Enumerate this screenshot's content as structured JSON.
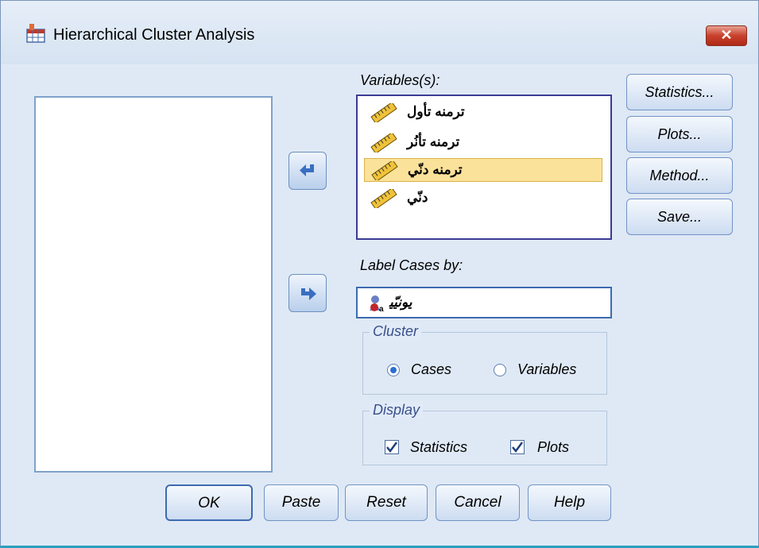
{
  "window": {
    "title": "Hierarchical Cluster Analysis",
    "close_label": "✕"
  },
  "variables": {
    "label": "Variables(s):",
    "items": [
      {
        "text": "ﺗﺮﻣﻨﻪ ﺗﺄﻭﻝ",
        "selected": false
      },
      {
        "text": "ﺗﺮﻣﻨﻪ ﺗﺄﻧُﺮ",
        "selected": false
      },
      {
        "text": "ﺗﺮﻣﻨﻪ ﺩﻧّﻲ",
        "selected": true
      },
      {
        "text": "ﺩﻧّﻲ",
        "selected": false
      }
    ]
  },
  "label_cases": {
    "label": "Label Cases by:",
    "value": "ﻳﻮﻧﻴّﻴ"
  },
  "side_buttons": {
    "statistics": "Statistics...",
    "plots": "Plots...",
    "method": "Method...",
    "save": "Save..."
  },
  "cluster": {
    "title": "Cluster",
    "cases": "Cases",
    "variables": "Variables",
    "selected": "cases"
  },
  "display": {
    "title": "Display",
    "statistics": "Statistics",
    "plots": "Plots",
    "statistics_checked": true,
    "plots_checked": true
  },
  "buttons": {
    "ok": "OK",
    "paste": "Paste",
    "reset": "Reset",
    "cancel": "Cancel",
    "help": "Help"
  },
  "icons": {
    "app": "table-icon",
    "scale": "ruler-icon",
    "nominal": "person-icon",
    "move_left": "arrow-left-icon",
    "move_right": "arrow-right-icon"
  },
  "colors": {
    "accent": "#3d6ab0",
    "selection": "#fbe29a",
    "close": "#c8402c"
  }
}
